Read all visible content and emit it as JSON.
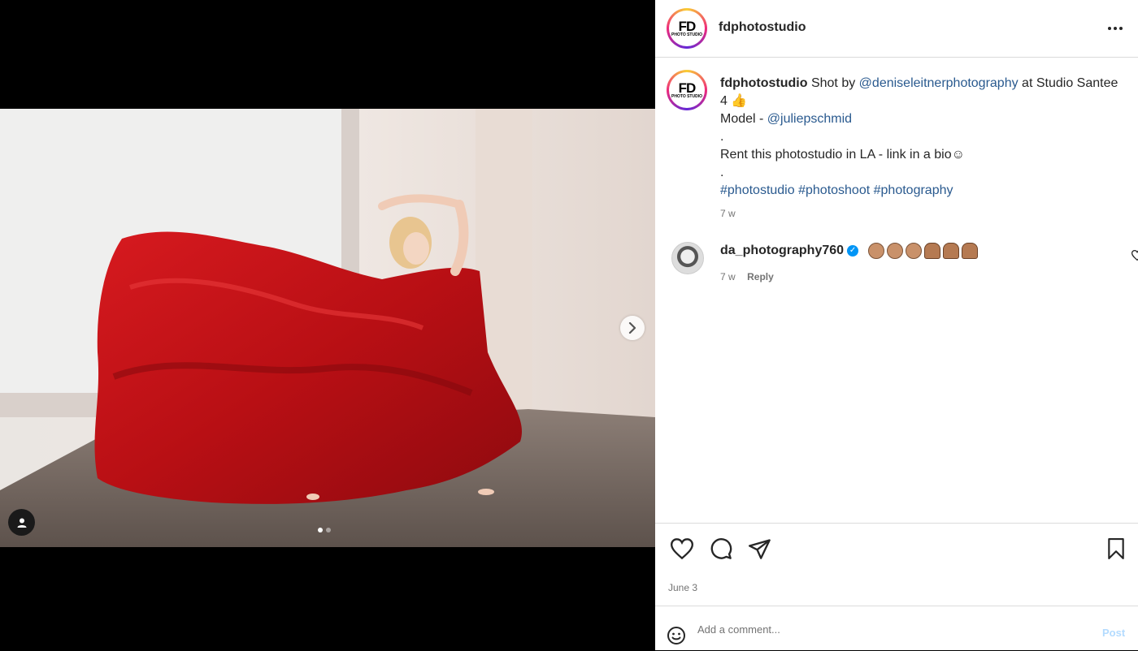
{
  "post": {
    "image_alt": "Dancer in flowing red dress in a white studio",
    "carousel": {
      "current": 1,
      "total": 2
    },
    "icons": {
      "next": "chevron-right-icon",
      "tagged_users": "user-icon"
    }
  },
  "header": {
    "username": "fdphotostudio",
    "avatar_logo": "FD",
    "avatar_logo_sub": "PHOTO STUDIO",
    "more_icon": "more-horizontal-icon",
    "more_label": "···"
  },
  "caption": {
    "username": "fdphotostudio",
    "text1": " Shot by ",
    "mention1": "@deniseleitnerphotography",
    "text2": " at Studio Santee 4 ",
    "emoji1": "👍",
    "line2_prefix": "Model - ",
    "mention2": "@juliepschmid",
    "dot1": ".",
    "line4": "Rent this photostudio in LA - link in a bio☺",
    "dot2": ".",
    "hashtag1": "#photostudio",
    "hashtag2": "#photoshoot",
    "hashtag3": "#photography",
    "time": "7 w"
  },
  "comments": [
    {
      "username": "da_photography760",
      "verified": true,
      "verified_icon": "verified-badge-icon",
      "emojis": [
        "clap",
        "clap",
        "clap",
        "pray",
        "pray",
        "pray"
      ],
      "time": "7 w",
      "reply_label": "Reply",
      "like_icon": "heart-icon"
    }
  ],
  "actions": {
    "like_icon": "heart-icon",
    "comment_icon": "comment-icon",
    "share_icon": "send-icon",
    "save_icon": "bookmark-icon",
    "date": "June 3"
  },
  "add_comment": {
    "emoji_icon": "smiley-icon",
    "placeholder": "Add a comment...",
    "post_label": "Post"
  },
  "colors": {
    "link": "#2a5a8f",
    "verified": "#0095f6",
    "post_disabled": "#b3dbff",
    "dress": "#c0141a"
  }
}
